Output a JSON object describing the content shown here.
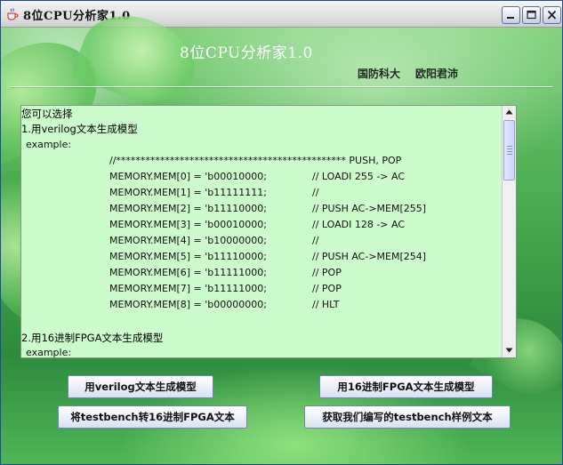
{
  "window": {
    "title": "8位CPU分析家1.0",
    "controls": {
      "minimize": "minimize-icon",
      "maximize": "maximize-icon",
      "close": "close-icon"
    },
    "app_icon": "java-coffee-cup-icon"
  },
  "header": {
    "heading": "8位CPU分析家1.0",
    "org": "国防科大",
    "author": "欧阳君沛"
  },
  "textarea": {
    "intro": "您可以选择",
    "option1_heading": "1.用verilog文本生成模型",
    "example_label1": "example:",
    "banner": "//*********************************************** PUSH, POP",
    "memory_lines": [
      {
        "code": "MEMORY.MEM[0] = 'b00010000;",
        "comment": "// LOADI 255 -> AC"
      },
      {
        "code": "MEMORY.MEM[1] = 'b11111111;",
        "comment": "//"
      },
      {
        "code": "MEMORY.MEM[2] = 'b11110000;",
        "comment": "// PUSH AC->MEM[255]"
      },
      {
        "code": "MEMORY.MEM[3] = 'b00010000;",
        "comment": "// LOADI 128 -> AC"
      },
      {
        "code": "MEMORY.MEM[4] = 'b10000000;",
        "comment": "//"
      },
      {
        "code": "MEMORY.MEM[5] = 'b11110000;",
        "comment": "// PUSH AC->MEM[254]"
      },
      {
        "code": "MEMORY.MEM[6] = 'b11111000;",
        "comment": "// POP"
      },
      {
        "code": "MEMORY.MEM[7] = 'b11111000;",
        "comment": "// POP"
      },
      {
        "code": "MEMORY.MEM[8] = 'b00000000;",
        "comment": "// HLT"
      }
    ],
    "option2_heading": "2.用16进制FPGA文本生成模型",
    "example_label2": "example:"
  },
  "buttons": {
    "verilog_gen": "用verilog文本生成模型",
    "fpga_gen": "用16进制FPGA文本生成模型",
    "testbench_convert": "将testbench转16进制FPGA文本",
    "get_sample": "获取我们编写的testbench样例文本"
  },
  "colors": {
    "textarea_bg": "#ccfccc",
    "heading_text": "#ffffff",
    "titlebar": "#e2e2e2"
  }
}
